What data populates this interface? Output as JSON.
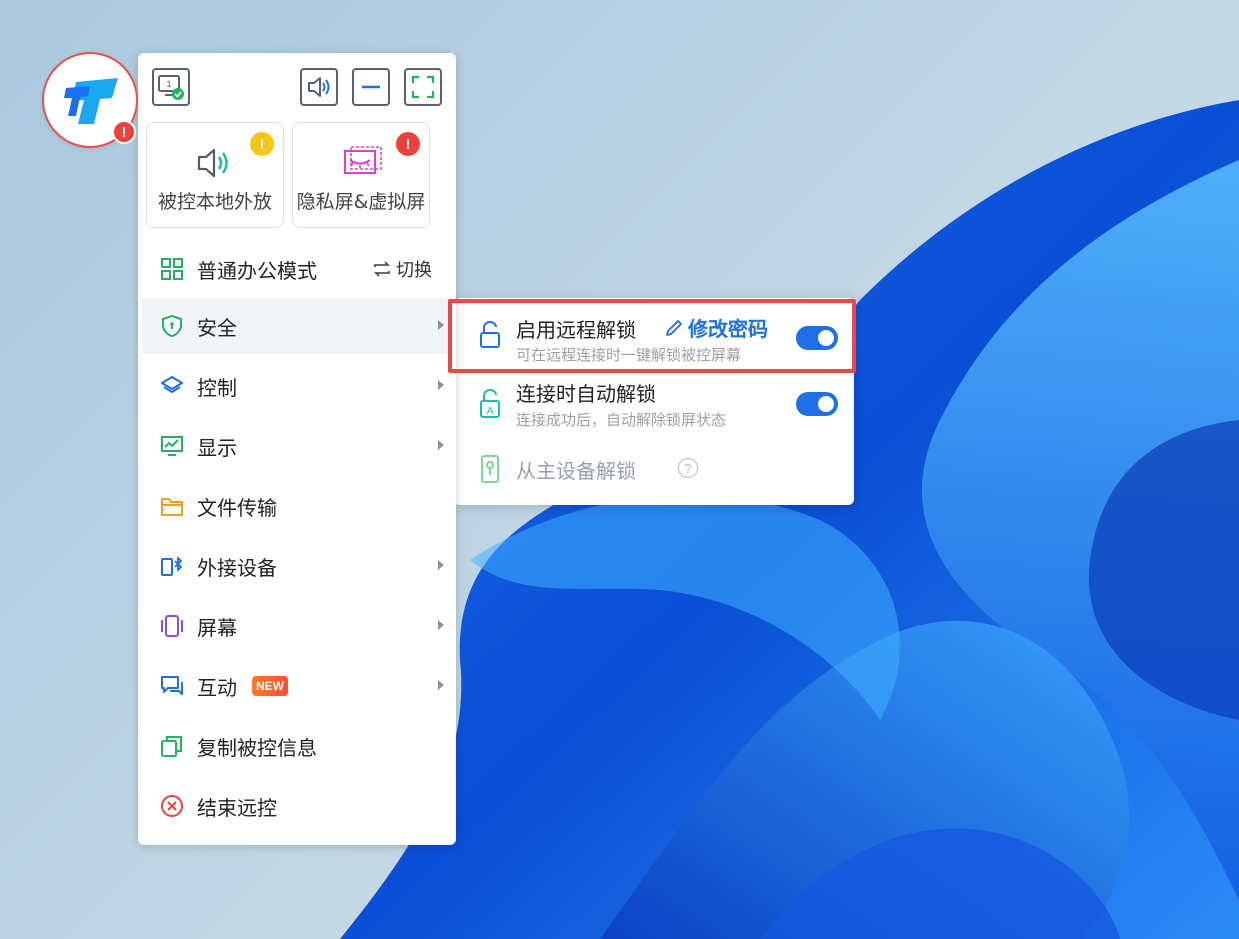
{
  "app": {
    "logo_alert": "!"
  },
  "toolbar": {
    "monitor_number": "1"
  },
  "cards": [
    {
      "label": "被控本地外放",
      "badge": "!",
      "badge_color": "#f5c518"
    },
    {
      "label": "隐私屏&虚拟屏",
      "badge": "!",
      "badge_color": "#f0403c"
    }
  ],
  "menu": {
    "mode_label": "普通办公模式",
    "switch_label": "切换",
    "items": [
      {
        "label": "安全"
      },
      {
        "label": "控制"
      },
      {
        "label": "显示"
      },
      {
        "label": "文件传输"
      },
      {
        "label": "外接设备"
      },
      {
        "label": "屏幕"
      },
      {
        "label": "互动",
        "badge": "NEW"
      },
      {
        "label": "复制被控信息"
      },
      {
        "label": "结束远控"
      }
    ]
  },
  "security_submenu": {
    "items": [
      {
        "title": "启用远程解锁",
        "action": "修改密码",
        "desc": "可在远程连接时一键解锁被控屏幕",
        "enabled": true
      },
      {
        "title": "连接时自动解锁",
        "desc": "连接成功后，自动解除锁屏状态",
        "enabled": true
      },
      {
        "title": "从主设备解锁",
        "help": "?"
      }
    ]
  },
  "colors": {
    "accent": "#1e6fe8",
    "highlight": "#e84a4a",
    "alert_red": "#f0403c",
    "alert_yellow": "#f5c518"
  }
}
